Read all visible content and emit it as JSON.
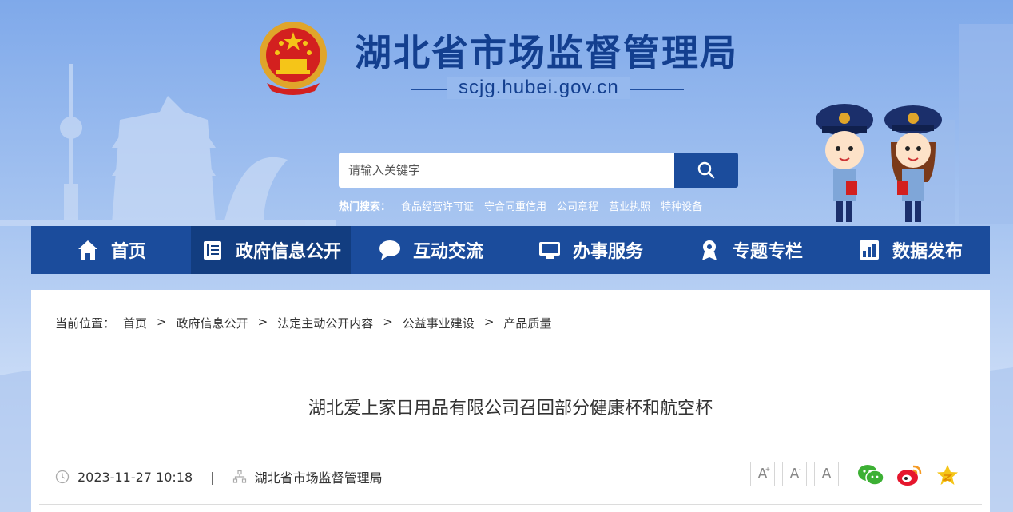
{
  "header": {
    "site_title": "湖北省市场监督管理局",
    "domain": "scjg.hubei.gov.cn"
  },
  "search": {
    "placeholder": "请输入关键字",
    "hot_label": "热门搜索：",
    "hot_terms": [
      "食品经营许可证",
      "守合同重信用",
      "公司章程",
      "营业执照",
      "特种设备"
    ]
  },
  "nav": {
    "items": [
      {
        "label": "首页",
        "icon": "home-icon"
      },
      {
        "label": "政府信息公开",
        "icon": "document-list-icon"
      },
      {
        "label": "互动交流",
        "icon": "chat-bubble-icon"
      },
      {
        "label": "办事服务",
        "icon": "monitor-icon"
      },
      {
        "label": "专题专栏",
        "icon": "badge-icon"
      },
      {
        "label": "数据发布",
        "icon": "bar-chart-icon"
      }
    ],
    "active_index": 1
  },
  "breadcrumb": {
    "label": "当前位置：",
    "items": [
      "首页",
      "政府信息公开",
      "法定主动公开内容",
      "公益事业建设",
      "产品质量"
    ],
    "separator": ">"
  },
  "article": {
    "title": "湖北爱上家日用品有限公司召回部分健康杯和航空杯",
    "datetime": "2023-11-27 10:18",
    "meta_separator": "|",
    "source": "湖北省市场监督管理局"
  },
  "font_size": {
    "increase": "A",
    "decrease": "A",
    "reset": "A"
  },
  "share": {
    "icons": [
      "wechat-icon",
      "weibo-icon",
      "favorite-star-icon"
    ]
  },
  "colors": {
    "nav_bg": "#1b4c9c",
    "nav_active": "#123d80",
    "title_blue": "#133f8f"
  }
}
